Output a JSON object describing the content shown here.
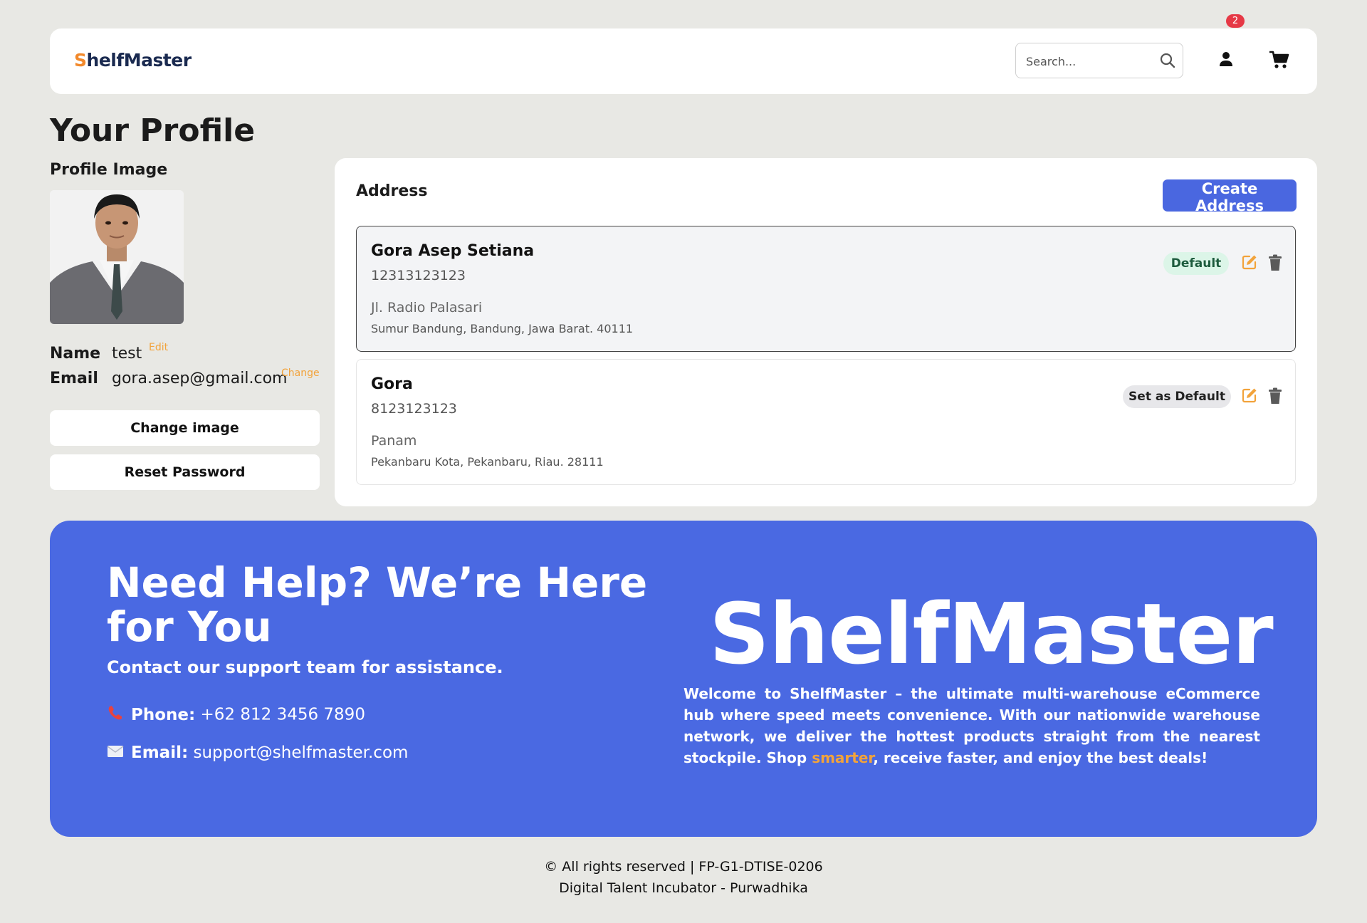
{
  "navbar": {
    "logo_s": "S",
    "logo_rest": "helfMaster",
    "search_placeholder": "Search...",
    "cart_count": "2"
  },
  "profile": {
    "page_title": "Your Profile",
    "image_label": "Profile Image",
    "name_label": "Name",
    "name_value": "test",
    "name_edit_link": "Edit",
    "email_label": "Email",
    "email_value": "gora.asep@gmail.com",
    "email_change_link": "Change",
    "change_image_button": "Change image",
    "reset_password_button": "Reset Password"
  },
  "address": {
    "title": "Address",
    "create_button": "Create Address",
    "items": [
      {
        "name": "Gora Asep Setiana",
        "phone": "12313123123",
        "street": "Jl. Radio Palasari",
        "region": "Sumur Bandung, Bandung, Jawa Barat. 40111",
        "badge": "Default"
      },
      {
        "name": "Gora",
        "phone": "8123123123",
        "street": "Panam",
        "region": "Pekanbaru Kota, Pekanbaru, Riau. 28111",
        "badge": "Set as Default"
      }
    ]
  },
  "footer": {
    "help_title": "Need Help? We’re Here for You",
    "help_subtitle": "Contact our support team for assistance.",
    "phone_label": "Phone:",
    "phone_value": "+62 812 3456 7890",
    "email_label": "Email:",
    "email_value": "support@shelfmaster.com",
    "brand": "ShelfMaster",
    "brand_desc_before": "Welcome to ShelfMaster – the ultimate multi-warehouse eCommerce hub where speed meets convenience. With our nationwide warehouse network, we deliver the hottest products straight from the nearest stockpile. Shop ",
    "brand_desc_highlight": "smarter",
    "brand_desc_after": ", receive faster, and enjoy the best deals!",
    "copyright_line1": "© All rights reserved | FP-G1-DTISE-0206",
    "copyright_line2": "Digital Talent Incubator - Purwadhika"
  },
  "colors": {
    "background": "#e8e8e4",
    "accent_blue": "#4a67e0",
    "accent_orange": "#f2a33b",
    "badge_red": "#e63946",
    "default_badge_bg": "#dcf5e8"
  },
  "icons": [
    "search-icon",
    "user-icon",
    "cart-icon",
    "edit-icon",
    "trash-icon",
    "phone-icon",
    "email-icon"
  ]
}
